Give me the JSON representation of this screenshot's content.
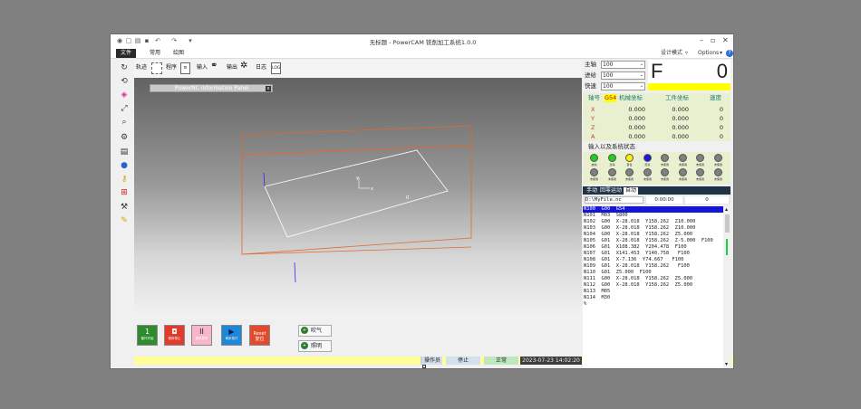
{
  "window": {
    "title": "无标题 - PowerCAM 铣削加工系统1.0.0",
    "controls": {
      "minimize": "–",
      "maximize": "▫",
      "close": "✕"
    }
  },
  "menubar": {
    "items": [
      "文件",
      "常用",
      "绘图"
    ],
    "right": {
      "design_mode": "设计模式",
      "options": "Options"
    }
  },
  "left_toolbar": {
    "icons": [
      "rotate-icon",
      "undo-icon",
      "target-icon",
      "fit-icon",
      "zoom-icon",
      "settings-icon",
      "save-icon",
      "user-icon",
      "key-icon",
      "grid-icon",
      "wrench-icon",
      "pencil-icon"
    ]
  },
  "top_toolbar": {
    "items": [
      {
        "label": "轨迹",
        "icon": "select-icon"
      },
      {
        "label": "程序",
        "icon": "document-icon"
      },
      {
        "label": "输入",
        "icon": "input-icon"
      },
      {
        "label": "输出",
        "icon": "output-icon"
      },
      {
        "label": "日志",
        "icon": "log-icon"
      }
    ],
    "log_icon_text": "LOG"
  },
  "info_panel": {
    "title": "PowerNC Information Panel",
    "close": "x"
  },
  "viewport": {
    "axis_label_x": "x",
    "axis_label_y": "y",
    "origin_label": "0"
  },
  "control_buttons": [
    {
      "label": "循环开始",
      "icon": "1",
      "color": "#2e8b2e"
    },
    {
      "label": "程序停止",
      "icon": "◘",
      "color": "#e23b2b"
    },
    {
      "label": "程序暂停",
      "icon": "II",
      "color": "#f7b7c8"
    },
    {
      "label": "单步执行",
      "icon": "▶",
      "color": "#1e88d8"
    },
    {
      "label": "Reset\n复位",
      "icon": "",
      "color": "#e24a2e"
    }
  ],
  "small_buttons": [
    {
      "label": "吹气",
      "icon": "+"
    },
    {
      "label": "照明",
      "icon": "+"
    }
  ],
  "status_bar": {
    "operator": "操作员",
    "state": "停止",
    "mode": "正常",
    "datetime": "2023-07-23 14:02:20"
  },
  "spindle": {
    "rows": [
      {
        "label": "主轴",
        "value": "100"
      },
      {
        "label": "进给",
        "value": "100"
      },
      {
        "label": "快速",
        "value": "100"
      }
    ],
    "f_label": "F",
    "f_value": "0"
  },
  "coords": {
    "headers": {
      "axis": "轴号",
      "wcs": "G54",
      "machine": "机械坐标",
      "work": "工件坐标",
      "speed": "速度"
    },
    "rows": [
      {
        "axis": "X",
        "machine": "0.000",
        "work": "0.000",
        "speed": "0"
      },
      {
        "axis": "Y",
        "machine": "0.000",
        "work": "0.000",
        "speed": "0"
      },
      {
        "axis": "Z",
        "machine": "0.000",
        "work": "0.000",
        "speed": "0"
      },
      {
        "axis": "A",
        "machine": "0.000",
        "work": "0.000",
        "speed": "0"
      }
    ]
  },
  "io_status": {
    "title": "输入以及系统状态",
    "row1": [
      {
        "label": "启动",
        "color": "#22cc22"
      },
      {
        "label": "急停",
        "color": "#22cc22"
      },
      {
        "label": "复位",
        "color": "#ffee00"
      },
      {
        "label": "原点",
        "color": "#1b1bd6"
      },
      {
        "label": "未使用",
        "color": "#808080"
      },
      {
        "label": "未使用",
        "color": "#808080"
      },
      {
        "label": "未使用",
        "color": "#808080"
      },
      {
        "label": "未使用",
        "color": "#808080"
      }
    ],
    "row2": [
      {
        "label": "未使用",
        "color": "#808080"
      },
      {
        "label": "未使用",
        "color": "#808080"
      },
      {
        "label": "未使用",
        "color": "#808080"
      },
      {
        "label": "未使用",
        "color": "#808080"
      },
      {
        "label": "未使用",
        "color": "#808080"
      },
      {
        "label": "未使用",
        "color": "#808080"
      },
      {
        "label": "未使用",
        "color": "#808080"
      },
      {
        "label": "未使用",
        "color": "#808080"
      }
    ]
  },
  "mode_tabs": [
    "手动",
    "回零运动",
    "自动"
  ],
  "file_info": {
    "path": "D:\\MyFile.nc",
    "time": "0:00:00",
    "count": "0"
  },
  "gcode": [
    "N100  G00  G54",
    "N101  M03  S800",
    "N102  G00  X-28.018  Y158.262  Z10.000",
    "N103  G00  X-28.018  Y158.262  Z10.000",
    "N104  G00  X-28.018  Y158.262  Z5.000",
    "N105  G01  X-28.018  Y158.262  Z-5.000  F100",
    "N106  G01  X108.382  Y204.478  F100",
    "N107  G01  X141.453  Y140.758   F100",
    "N108  G01  X-7.136  Y74.667   F100",
    "N109  G01  X-28.018  Y158.262   F100",
    "N110  G01  Z5.000  F100",
    "N111  G00  X-28.018  Y158.262  Z5.000",
    "N112  G00  X-28.018  Y158.262  Z5.000",
    "N113  M05",
    "N114  M30",
    "%"
  ]
}
